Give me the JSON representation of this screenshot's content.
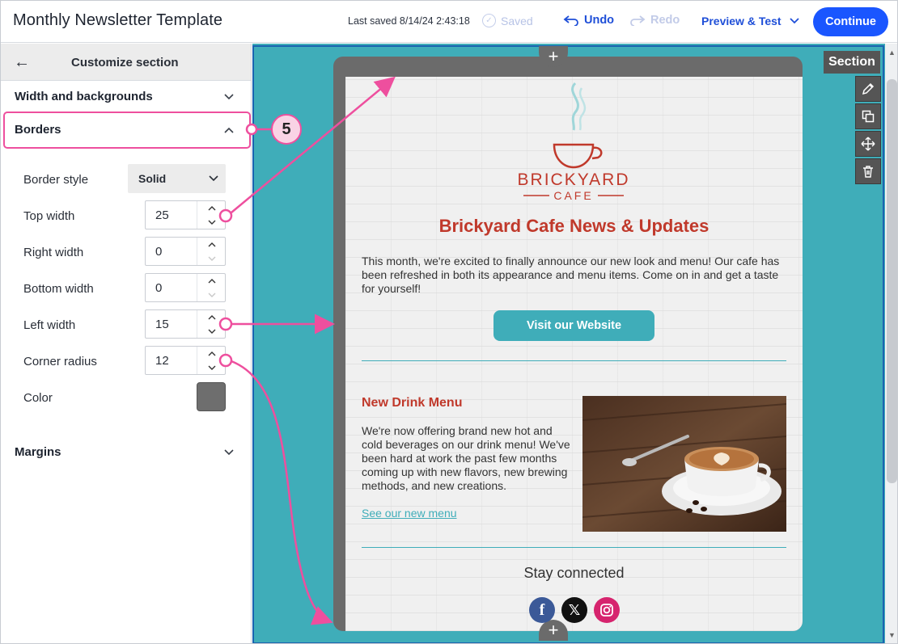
{
  "header": {
    "title": "Monthly Newsletter Template",
    "last_saved": "Last saved 8/14/24 2:43:18",
    "saved_label": "Saved",
    "undo_label": "Undo",
    "redo_label": "Redo",
    "preview_label": "Preview & Test",
    "continue_label": "Continue"
  },
  "panel": {
    "title": "Customize section",
    "sections": {
      "width_bg": "Width and backgrounds",
      "borders": "Borders",
      "margins": "Margins"
    },
    "step_number": "5",
    "fields": {
      "border_style_label": "Border style",
      "border_style_value": "Solid",
      "top_width_label": "Top width",
      "top_width_value": "25",
      "right_width_label": "Right width",
      "right_width_value": "0",
      "bottom_width_label": "Bottom width",
      "bottom_width_value": "0",
      "left_width_label": "Left width",
      "left_width_value": "15",
      "corner_radius_label": "Corner radius",
      "corner_radius_value": "12",
      "color_label": "Color",
      "color_value": "#6e6e6e"
    }
  },
  "canvas": {
    "section_tag": "Section",
    "tools": [
      "pencil-icon",
      "duplicate-icon",
      "move-icon",
      "trash-icon"
    ],
    "email": {
      "logo_text": "BRICKYARD",
      "logo_subtext": "CAFE",
      "title": "Brickyard Cafe News & Updates",
      "intro": "This month, we're excited to finally announce our new look and menu! Our cafe has been refreshed in both its appearance and menu items. Come on in and get a taste for yourself!",
      "button": "Visit our Website",
      "drink_title": "New Drink Menu",
      "drink_text": "We're now offering brand new hot and cold beverages on our drink menu! We've been hard at work the past few months coming up with new flavors, new brewing methods, and new creations.",
      "drink_link": "See our new menu",
      "stay_connected": "Stay connected",
      "social": [
        "facebook-icon",
        "x-icon",
        "instagram-icon"
      ]
    }
  },
  "colors": {
    "accent_blue": "#1a56ff",
    "canvas_teal": "#3fadb9",
    "border_gray": "#6b6b6b",
    "title_red": "#c0392b",
    "annotation_pink": "#ee4f9e"
  }
}
